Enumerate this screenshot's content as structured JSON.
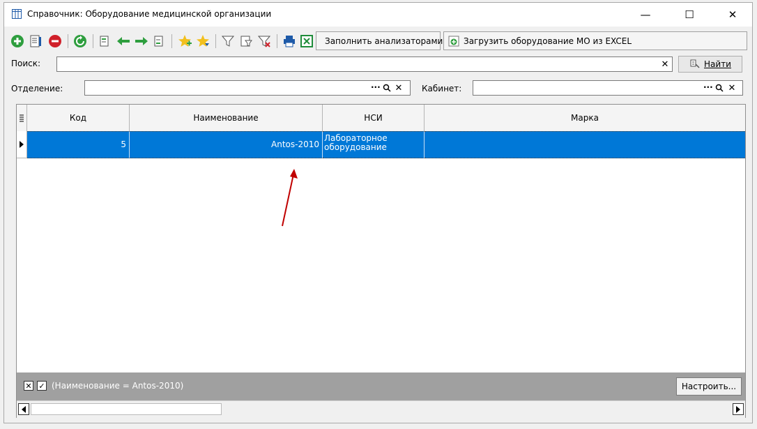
{
  "window": {
    "title": "Справочник: Оборудование медицинской организации",
    "minimize": "—",
    "maximize": "☐",
    "close": "✕"
  },
  "toolbar": {
    "fill_analyzers_label": "Заполнить анализаторами",
    "load_excel_label": "Загрузить оборудование МО из EXCEL"
  },
  "search": {
    "label": "Поиск:",
    "value": "",
    "find_label": "Найти"
  },
  "filters": {
    "department_label": "Отделение:",
    "department_value": "",
    "cabinet_label": "Кабинет:",
    "cabinet_value": ""
  },
  "grid": {
    "columns": [
      "Код",
      "Наименование",
      "НСИ",
      "Марка"
    ],
    "rows": [
      {
        "code": "5",
        "name": "Antos-2010",
        "nsi_line1": "Лабораторное",
        "nsi_line2": "оборудование",
        "brand": ""
      }
    ]
  },
  "filterbar": {
    "filter_text": "(Наименование = Antos-2010)",
    "setup_label": "Настроить..."
  },
  "colors": {
    "selection": "#0078d7",
    "arrow": "#c00000"
  }
}
